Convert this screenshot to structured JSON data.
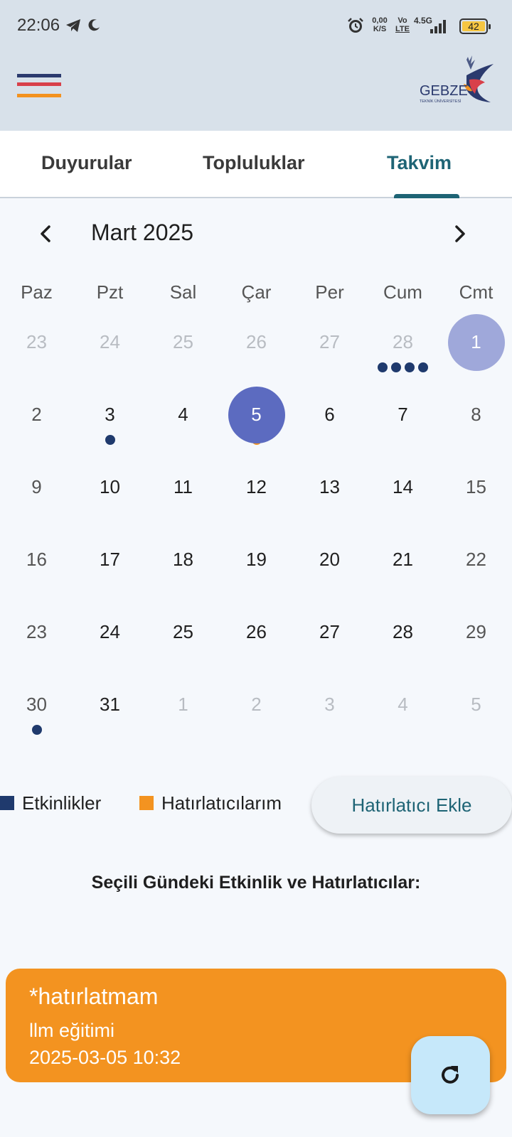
{
  "status_bar": {
    "time": "22:06",
    "net_speed_value": "0,00",
    "net_speed_unit": "K/S",
    "volte_top": "Vo",
    "volte_bottom": "LTE",
    "network": "4.5G",
    "battery_level": "42",
    "icons": [
      "telegram-icon",
      "moon-icon",
      "alarm-icon",
      "signal-icon",
      "battery-icon"
    ]
  },
  "app_bar": {
    "menu_icon": "hamburger-icon",
    "menu_colors": [
      "#2b3a6e",
      "#d8404a",
      "#f3921f"
    ],
    "logo_text": "GEBZE",
    "logo_subtext": "TEKNİK ÜNİVERSİTESİ"
  },
  "tabs": [
    {
      "label": "Duyurular",
      "active": false
    },
    {
      "label": "Topluluklar",
      "active": false
    },
    {
      "label": "Takvim",
      "active": true
    }
  ],
  "calendar": {
    "month_title": "Mart 2025",
    "prev_icon": "chevron-left-icon",
    "next_icon": "chevron-right-icon",
    "weekdays": [
      "Paz",
      "Pzt",
      "Sal",
      "Çar",
      "Per",
      "Cum",
      "Cmt"
    ],
    "weeks": [
      [
        {
          "d": "23",
          "muted": true
        },
        {
          "d": "24",
          "muted": true
        },
        {
          "d": "25",
          "muted": true
        },
        {
          "d": "26",
          "muted": true
        },
        {
          "d": "27",
          "muted": true
        },
        {
          "d": "28",
          "muted": true,
          "dots": [
            "event",
            "event",
            "event",
            "event"
          ]
        },
        {
          "d": "1",
          "today": true
        }
      ],
      [
        {
          "d": "2",
          "weekend": true
        },
        {
          "d": "3",
          "dots": [
            "event"
          ]
        },
        {
          "d": "4"
        },
        {
          "d": "5",
          "selected": true,
          "dots": [
            "reminder"
          ]
        },
        {
          "d": "6"
        },
        {
          "d": "7"
        },
        {
          "d": "8",
          "weekend": true
        }
      ],
      [
        {
          "d": "9",
          "weekend": true
        },
        {
          "d": "10"
        },
        {
          "d": "11"
        },
        {
          "d": "12"
        },
        {
          "d": "13"
        },
        {
          "d": "14"
        },
        {
          "d": "15",
          "weekend": true
        }
      ],
      [
        {
          "d": "16",
          "weekend": true
        },
        {
          "d": "17"
        },
        {
          "d": "18"
        },
        {
          "d": "19"
        },
        {
          "d": "20"
        },
        {
          "d": "21"
        },
        {
          "d": "22",
          "weekend": true
        }
      ],
      [
        {
          "d": "23",
          "weekend": true
        },
        {
          "d": "24"
        },
        {
          "d": "25"
        },
        {
          "d": "26"
        },
        {
          "d": "27"
        },
        {
          "d": "28"
        },
        {
          "d": "29",
          "weekend": true
        }
      ],
      [
        {
          "d": "30",
          "weekend": true,
          "dots": [
            "event"
          ]
        },
        {
          "d": "31"
        },
        {
          "d": "1",
          "muted": true
        },
        {
          "d": "2",
          "muted": true
        },
        {
          "d": "3",
          "muted": true
        },
        {
          "d": "4",
          "muted": true
        },
        {
          "d": "5",
          "muted": true
        }
      ]
    ]
  },
  "legend": {
    "events_label": "Etkinlikler",
    "reminders_label": "Hatırlatıcılarım",
    "add_button": "Hatırlatıcı Ekle"
  },
  "selected_day": {
    "title": "Seçili Gündeki Etkinlik ve Hatırlatıcılar:",
    "items": [
      {
        "title": "*hatırlatmam",
        "description": "llm eğitimi",
        "datetime": "2025-03-05 10:32"
      }
    ]
  },
  "fab": {
    "icon": "refresh-icon"
  },
  "colors": {
    "event": "#1f3a6d",
    "reminder": "#f39320",
    "selected": "#5c6bc0",
    "today": "#9fa8da",
    "accent": "#1e6475",
    "muted_text": "#b8bcc2",
    "weekend_text": "#555555",
    "day_text": "#1f1f1f"
  }
}
